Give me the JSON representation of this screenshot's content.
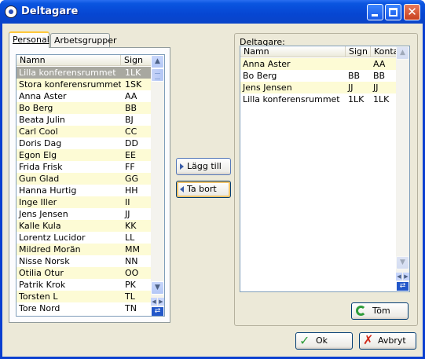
{
  "window": {
    "title": "Deltagare"
  },
  "tabs": [
    {
      "label": "Personal",
      "active": true
    },
    {
      "label": "Arbetsgrupper",
      "active": false
    }
  ],
  "personal_list": {
    "columns": [
      "Namn",
      "Sign"
    ],
    "rows": [
      [
        "Lilla konferensrummet",
        "1LK"
      ],
      [
        "Stora konferensrummet",
        "1SK"
      ],
      [
        "Anna Aster",
        "AA"
      ],
      [
        "Bo Berg",
        "BB"
      ],
      [
        "Beata Julin",
        "BJ"
      ],
      [
        "Carl Cool",
        "CC"
      ],
      [
        "Doris Dag",
        "DD"
      ],
      [
        "Egon Elg",
        "EE"
      ],
      [
        "Frida Frisk",
        "FF"
      ],
      [
        "Gun Glad",
        "GG"
      ],
      [
        "Hanna Hurtig",
        "HH"
      ],
      [
        "Inge Iller",
        "II"
      ],
      [
        "Jens Jensen",
        "JJ"
      ],
      [
        "Kalle Kula",
        "KK"
      ],
      [
        "Lorentz Lucidor",
        "LL"
      ],
      [
        "Mildred Morän",
        "MM"
      ],
      [
        "Nisse Norsk",
        "NN"
      ],
      [
        "Otilia Otur",
        "OO"
      ],
      [
        "Patrik Krok",
        "PK"
      ],
      [
        "Torsten L",
        "TL"
      ],
      [
        "Tore Nord",
        "TN"
      ]
    ]
  },
  "buttons": {
    "add": "Lägg till",
    "remove": "Ta bort",
    "clear": "Töm",
    "ok": "Ok",
    "cancel": "Avbryt"
  },
  "participants": {
    "label": "Deltagare:",
    "columns": [
      "Namn",
      "Sign",
      "Konta"
    ],
    "rows": [
      [
        "Anna Aster",
        "",
        "AA"
      ],
      [
        "Bo Berg",
        "BB",
        "BB"
      ],
      [
        "Jens Jensen",
        "JJ",
        "JJ"
      ],
      [
        "Lilla konferensrummet",
        "1LK",
        "1LK"
      ]
    ]
  },
  "colors": {
    "titlebar": "#0a55e0",
    "selected_row": "#a8a8a0",
    "alt_row": "#fdfbd5",
    "dialog_bg": "#ece9d8"
  }
}
